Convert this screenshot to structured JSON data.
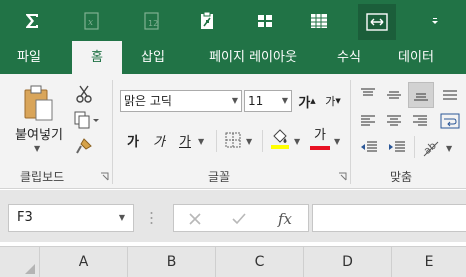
{
  "quick_access": {
    "buttons": [
      {
        "icon": "autosum-icon"
      },
      {
        "icon": "insert-function-disabled-icon"
      },
      {
        "icon": "format-number-disabled-icon"
      },
      {
        "icon": "clipboard-chart-icon"
      },
      {
        "icon": "grid-layout-icon"
      },
      {
        "icon": "table-icon"
      },
      {
        "icon": "fit-width-icon"
      },
      {
        "icon": "qat-dropdown-icon"
      }
    ]
  },
  "tabs": [
    {
      "label": "파일",
      "active": false
    },
    {
      "label": "홈",
      "active": true
    },
    {
      "label": "삽입",
      "active": false
    },
    {
      "label": "페이지 레이아웃",
      "active": false
    },
    {
      "label": "수식",
      "active": false
    },
    {
      "label": "데이터",
      "active": false
    }
  ],
  "ribbon": {
    "clipboard": {
      "group_label": "클립보드",
      "paste_label": "붙여넣기"
    },
    "font": {
      "group_label": "글꼴",
      "font_name": "맑은 고딕",
      "font_size": "11",
      "grow_label": "가",
      "shrink_label": "가",
      "bold_label": "가",
      "italic_label": "가",
      "underline_label": "가",
      "font_color_label": "가",
      "highlight_color": "#ffff00",
      "font_color": "#e81123"
    },
    "alignment": {
      "group_label": "맞춤"
    }
  },
  "formula_bar": {
    "name_box": "F3",
    "cancel_icon": "cancel-icon",
    "enter_icon": "enter-icon",
    "fx_label": "fx",
    "formula_value": ""
  },
  "columns": [
    "A",
    "B",
    "C",
    "D",
    "E"
  ],
  "colors": {
    "accent": "#217346",
    "ribbon_bg": "#f3f3f3"
  }
}
